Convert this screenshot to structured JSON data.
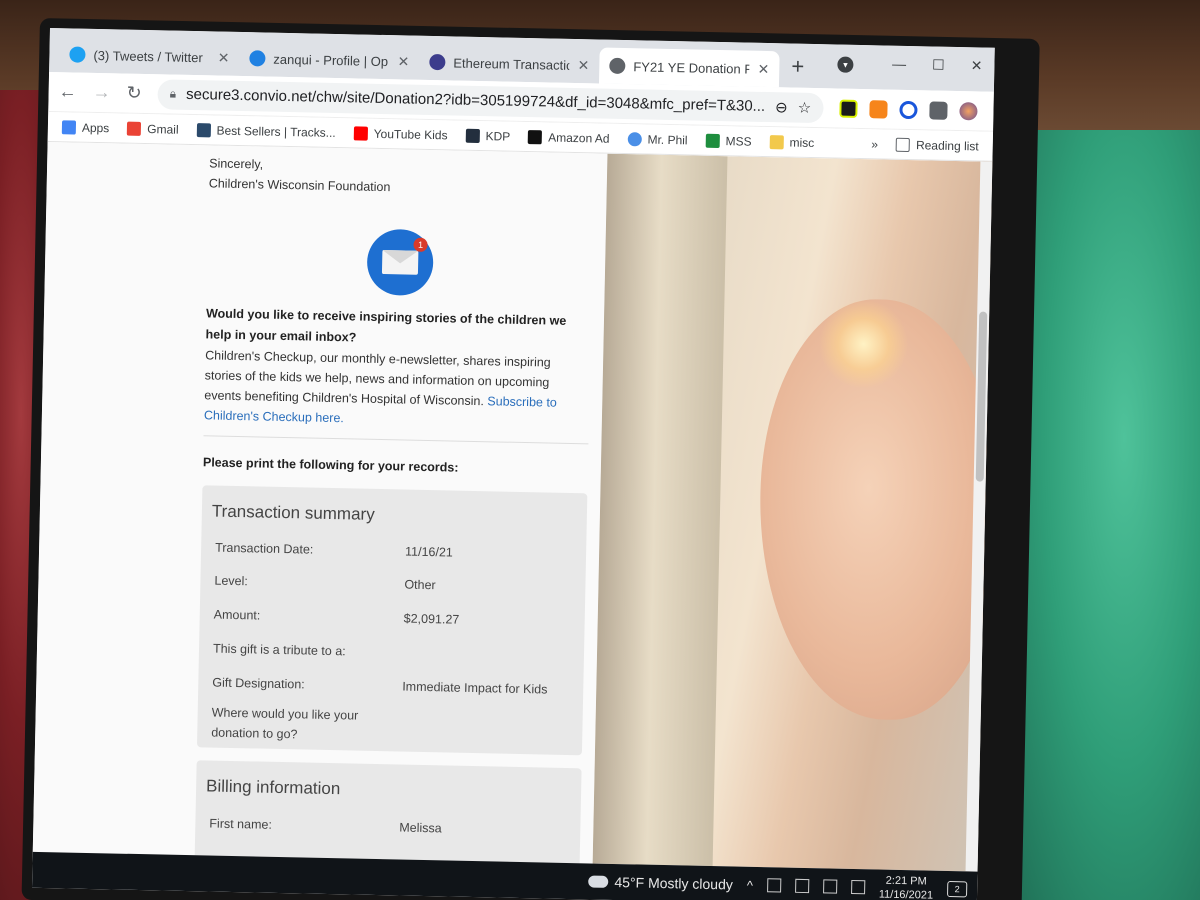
{
  "tabs": [
    {
      "title": "(3) Tweets / Twitter",
      "favicon_color": "#1da1f2"
    },
    {
      "title": "zanqui - Profile | Op",
      "favicon_color": "#2081e2"
    },
    {
      "title": "Ethereum Transactio",
      "favicon_color": "#3c3c8c"
    },
    {
      "title": "FY21 YE Donation F",
      "favicon_color": "#5f6368"
    }
  ],
  "active_tab_index": 3,
  "toolbar": {
    "back_icon": "←",
    "forward_icon": "→",
    "reload_icon": "↻",
    "url": "secure3.convio.net/chw/site/Donation2?idb=305199724&df_id=3048&mfc_pref=T&30...",
    "zoom_icon": "⊖",
    "star_icon": "☆",
    "menu_icon": "⋮"
  },
  "window_controls": {
    "minimize": "—",
    "maximize": "☐",
    "close": "✕"
  },
  "bookmarks": [
    {
      "label": "Apps",
      "color": "#4285f4"
    },
    {
      "label": "Gmail",
      "color": "#ea4335"
    },
    {
      "label": "Best Sellers | Tracks...",
      "color": "#2b4a6b"
    },
    {
      "label": "YouTube Kids",
      "color": "#ff0000"
    },
    {
      "label": "KDP",
      "color": "#232f3e"
    },
    {
      "label": "Amazon Ad",
      "color": "#111111"
    },
    {
      "label": "Mr. Phil",
      "color": "#4a8fe7"
    },
    {
      "label": "MSS",
      "color": "#1e8e3e"
    },
    {
      "label": "misc",
      "color": "#f2c94c"
    }
  ],
  "bookmarks_more": "»",
  "reading_list": "Reading list",
  "page": {
    "sincerely": "Sincerely,",
    "org": "Children's Wisconsin Foundation",
    "email_badge": "1",
    "newsletter_heading": "Would you like to receive inspiring stories of the children we help in your email inbox?",
    "newsletter_body": "Children's Checkup, our monthly e-newsletter, shares inspiring stories of the kids we help, news and information on upcoming events benefiting Children's Hospital of Wisconsin.",
    "newsletter_link": "Subscribe to Children's Checkup here.",
    "print_label": "Please print the following for your records:",
    "transaction": {
      "title": "Transaction summary",
      "rows": [
        {
          "label": "Transaction Date:",
          "value": "11/16/21"
        },
        {
          "label": "Level:",
          "value": "Other"
        },
        {
          "label": "Amount:",
          "value": "$2,091.27"
        },
        {
          "label": "This gift is a tribute to a:",
          "value": ""
        },
        {
          "label": "Gift Designation:",
          "value": "Immediate Impact for Kids"
        },
        {
          "label": "Where would you like your donation to go?",
          "value": ""
        }
      ]
    },
    "billing": {
      "title": "Billing information",
      "rows": [
        {
          "label": "First name:",
          "value": "Melissa"
        }
      ]
    }
  },
  "taskbar": {
    "weather": "45°F Mostly cloudy",
    "time": "2:21 PM",
    "date": "11/16/2021",
    "notification_count": "2"
  }
}
